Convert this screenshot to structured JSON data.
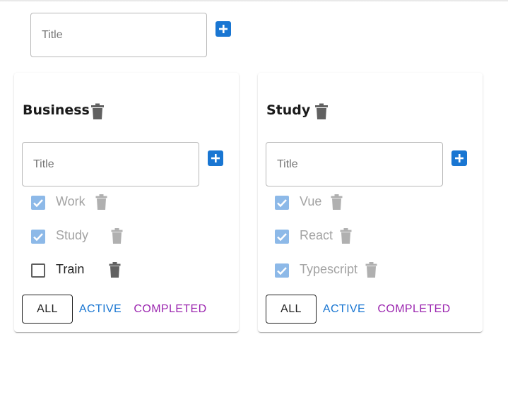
{
  "colors": {
    "primary": "#1976d2",
    "secondary": "#9c27b0",
    "checked_disabled": "#8db9e8",
    "trash_active": "#616161",
    "trash_disabled": "#b0b0b0"
  },
  "add_list": {
    "placeholder": "Title",
    "value": "",
    "add_icon": "plus-square-icon"
  },
  "lists": [
    {
      "title": "Business",
      "delete_icon": "trash-icon",
      "new_task_placeholder": "Title",
      "tasks": [
        {
          "label": "Work",
          "done": true
        },
        {
          "label": "Study",
          "done": true
        },
        {
          "label": "Train",
          "done": false
        }
      ],
      "filters": {
        "all": "ALL",
        "active": "ACTIVE",
        "completed": "COMPLETED",
        "selected": "all"
      }
    },
    {
      "title": "Study",
      "delete_icon": "trash-icon",
      "new_task_placeholder": "Title",
      "tasks": [
        {
          "label": "Vue",
          "done": true
        },
        {
          "label": "React",
          "done": true
        },
        {
          "label": "Typescript",
          "done": true
        }
      ],
      "filters": {
        "all": "ALL",
        "active": "ACTIVE",
        "completed": "COMPLETED",
        "selected": "all"
      }
    }
  ]
}
